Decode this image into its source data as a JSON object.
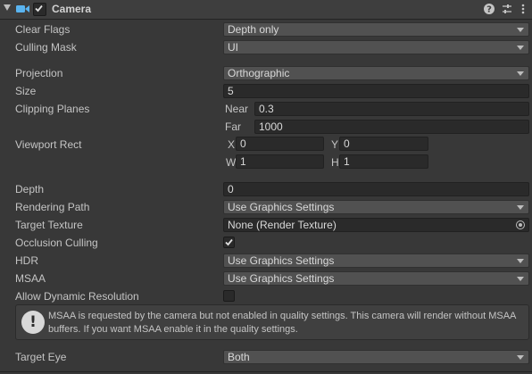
{
  "header": {
    "title": "Camera",
    "enabled": true
  },
  "fields": {
    "clear_flags": {
      "label": "Clear Flags",
      "value": "Depth only"
    },
    "culling_mask": {
      "label": "Culling Mask",
      "value": "UI"
    },
    "projection": {
      "label": "Projection",
      "value": "Orthographic"
    },
    "size": {
      "label": "Size",
      "value": "5"
    },
    "clipping": {
      "label": "Clipping Planes",
      "near_label": "Near",
      "near": "0.3",
      "far_label": "Far",
      "far": "1000"
    },
    "viewport": {
      "label": "Viewport Rect",
      "x_label": "X",
      "x": "0",
      "y_label": "Y",
      "y": "0",
      "w_label": "W",
      "w": "1",
      "h_label": "H",
      "h": "1"
    },
    "depth": {
      "label": "Depth",
      "value": "0"
    },
    "rendering_path": {
      "label": "Rendering Path",
      "value": "Use Graphics Settings"
    },
    "target_texture": {
      "label": "Target Texture",
      "value": "None (Render Texture)"
    },
    "occlusion_culling": {
      "label": "Occlusion Culling",
      "checked": true
    },
    "hdr": {
      "label": "HDR",
      "value": "Use Graphics Settings"
    },
    "msaa": {
      "label": "MSAA",
      "value": "Use Graphics Settings"
    },
    "allow_dynamic_resolution": {
      "label": "Allow Dynamic Resolution",
      "checked": false
    },
    "target_eye": {
      "label": "Target Eye",
      "value": "Both"
    }
  },
  "help": {
    "line1": "MSAA is requested by the camera but not enabled in quality settings. This camera will render without MSAA",
    "line2": "buffers. If you want MSAA enable it in the quality settings."
  },
  "colors": {
    "accent_icon": "#5ab4f0",
    "background": "#383838",
    "field": "#2a2a2a",
    "dropdown": "#515151"
  }
}
